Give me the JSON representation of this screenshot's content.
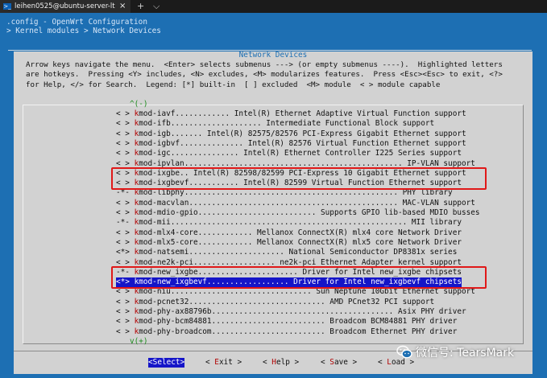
{
  "window": {
    "tab_title": "leihen0525@ubuntu-server-lt",
    "tab_close": "×",
    "new_tab": "+",
    "dropdown": "⌵"
  },
  "terminal": {
    "config_line": ".config - OpenWrt Configuration",
    "breadcrumb": "> Kernel modules > Network Devices",
    "underline": "────────────────────────────────────────────────────────────────────────────────────────────"
  },
  "dialog": {
    "title": "Network Devices",
    "help_lines": [
      "Arrow keys navigate the menu.  <Enter> selects submenus ---> (or empty submenus ----).  Highlighted letters",
      "are hotkeys.  Pressing <Y> includes, <N> excludes, <M> modularizes features.  Press <Esc><Esc> to exit, <?>",
      "for Help, </> for Search.  Legend: [*] built-in  [ ] excluded  <M> module  < > module capable"
    ],
    "scroll_up": "^(-)",
    "scroll_down": "v(+)",
    "items": [
      {
        "mark": "< >",
        "first": "k",
        "rest": "mod-iavf............ Intel(R) Ethernet Adaptive Virtual Function support"
      },
      {
        "mark": "< >",
        "first": "k",
        "rest": "mod-ifb.................... Intermediate Functional Block support"
      },
      {
        "mark": "< >",
        "first": "k",
        "rest": "mod-igb....... Intel(R) 82575/82576 PCI-Express Gigabit Ethernet support"
      },
      {
        "mark": "< >",
        "first": "k",
        "rest": "mod-igbvf.............. Intel(R) 82576 Virtual Function Ethernet support"
      },
      {
        "mark": "< >",
        "first": "k",
        "rest": "mod-igc............... Intel(R) Ethernet Controller I225 Series support"
      },
      {
        "mark": "< >",
        "first": "k",
        "rest": "mod-ipvlan................................................ IP-VLAN support"
      },
      {
        "mark": "< >",
        "first": "k",
        "rest": "mod-ixgbe.. Intel(R) 82598/82599 PCI-Express 10 Gigabit Ethernet support"
      },
      {
        "mark": "< >",
        "first": "k",
        "rest": "mod-ixgbevf........... Intel(R) 82599 Virtual Function Ethernet support"
      },
      {
        "mark": "-*-",
        "first": "k",
        "rest": "mod-libphy............................................... PHY library"
      },
      {
        "mark": "< >",
        "first": "k",
        "rest": "mod-macvlan.............................................. MAC-VLAN support"
      },
      {
        "mark": "< >",
        "first": "k",
        "rest": "mod-mdio-gpio.......................... Supports GPIO lib-based MDIO busses"
      },
      {
        "mark": "-*-",
        "first": "k",
        "rest": "mod-mii.................................................... MII library"
      },
      {
        "mark": "< >",
        "first": "k",
        "rest": "mod-mlx4-core............ Mellanox ConnectX(R) mlx4 core Network Driver"
      },
      {
        "mark": "< >",
        "first": "k",
        "rest": "mod-mlx5-core............ Mellanox ConnectX(R) mlx5 core Network Driver"
      },
      {
        "mark": "<*>",
        "first": "k",
        "rest": "mod-natsemi..................... National Semiconductor DP8381x series"
      },
      {
        "mark": "< >",
        "first": "k",
        "rest": "mod-ne2k-pci.................. ne2k-pci Ethernet Adapter kernel support"
      },
      {
        "mark": "-*-",
        "first": "k",
        "rest": "mod-new_ixgbe...................... Driver for Intel new_ixgbe chipsets"
      },
      {
        "mark": "<*>",
        "first": "k",
        "rest": "mod-new_ixgbevf.................. Driver for Intel new_ixgbevf chipsets"
      },
      {
        "mark": "< >",
        "first": "k",
        "rest": "mod-niu............................... Sun Neptune 10Gbit Ethernet support"
      },
      {
        "mark": "< >",
        "first": "k",
        "rest": "mod-pcnet32.............................. AMD PCnet32 PCI support"
      },
      {
        "mark": "< >",
        "first": "k",
        "rest": "mod-phy-ax88796b........................................ Asix PHY driver"
      },
      {
        "mark": "< >",
        "first": "k",
        "rest": "mod-phy-bcm84881......................... Broadcom BCM84881 PHY driver"
      },
      {
        "mark": "< >",
        "first": "k",
        "rest": "mod-phy-broadcom......................... Broadcom Ethernet PHY driver"
      }
    ],
    "buttons": {
      "select": {
        "pre": "<",
        "hk": "S",
        "post": "elect>"
      },
      "exit": {
        "pre": "< ",
        "hk": "E",
        "post": "xit >"
      },
      "help": {
        "pre": "< ",
        "hk": "H",
        "post": "elp >"
      },
      "save": {
        "pre": "< ",
        "hk": "S",
        "post": "ave >"
      },
      "load": {
        "pre": "< ",
        "hk": "L",
        "post": "oad >"
      }
    }
  },
  "watermark": {
    "text": "微信号: TearsMark"
  },
  "colors": {
    "terminal_bg": "#1d6fb3",
    "dialog_bg": "#d2d2d2",
    "selection": "#1515c8",
    "hotkey": "#b00000",
    "callout": "#e01818"
  }
}
